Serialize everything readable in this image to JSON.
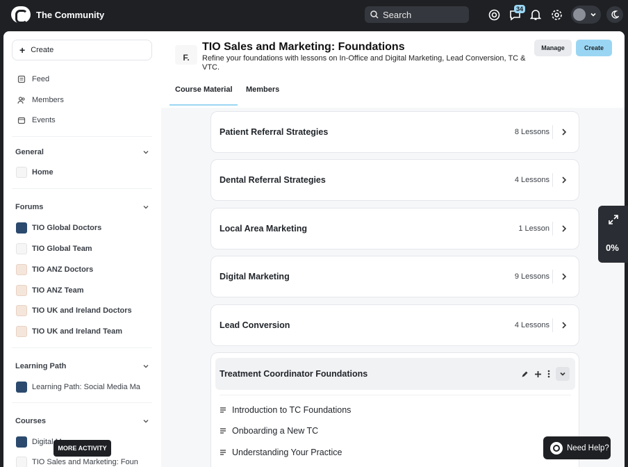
{
  "topbar": {
    "brand_name": "The Community",
    "search_placeholder": "Search",
    "notification_count": "34",
    "icons": [
      "support-icon",
      "messages-icon",
      "bell-icon",
      "settings-icon",
      "avatar",
      "chevron-down-icon",
      "moon-icon"
    ]
  },
  "sidebar": {
    "create_label": "Create",
    "nav": [
      {
        "label": "Feed",
        "icon": "feed-icon"
      },
      {
        "label": "Members",
        "icon": "members-icon"
      },
      {
        "label": "Events",
        "icon": "calendar-icon"
      }
    ],
    "sections": {
      "general": "General",
      "forums": "Forums",
      "learning_path": "Learning Path",
      "courses": "Courses"
    },
    "general_items": [
      "Home"
    ],
    "forum_items": [
      "TIO Global Doctors",
      "TIO Global Team",
      "TIO ANZ Doctors",
      "TIO ANZ Team",
      "TIO UK and Ireland Doctors",
      "TIO UK and Ireland Team"
    ],
    "learning_path_items": [
      "Learning Path: Social Media Ma"
    ],
    "course_items": [
      "Digital Ma",
      "TIO Sales and Marketing: Foun"
    ],
    "tooltip": "MORE ACTIVITY"
  },
  "course": {
    "logo_text": "F.",
    "title": "TIO Sales and Marketing: Foundations",
    "description": "Refine your foundations with lessons on In-Office and Digital Marketing, Lead Conversion, TC & VTC.",
    "manage_label": "Manage",
    "create_label": "Create",
    "tabs": [
      "Course Material",
      "Members"
    ],
    "active_tab": "Course Material"
  },
  "sections": [
    {
      "title": "Patient Referral Strategies",
      "count": "8 Lessons"
    },
    {
      "title": "Dental Referral Strategies",
      "count": "4 Lessons"
    },
    {
      "title": "Local Area Marketing",
      "count": "1 Lesson"
    },
    {
      "title": "Digital Marketing",
      "count": "9 Lessons"
    },
    {
      "title": "Lead Conversion",
      "count": "4 Lessons"
    }
  ],
  "expanded_section": {
    "title": "Treatment Coordinator Foundations",
    "lessons": [
      "Introduction to TC Foundations",
      "Onboarding a New TC",
      "Understanding Your Practice"
    ]
  },
  "progress_widget": {
    "progress": "0%"
  },
  "help_button": "Need Help?",
  "colors": {
    "accent": "#9ad6f3",
    "dark": "#1e2024"
  }
}
